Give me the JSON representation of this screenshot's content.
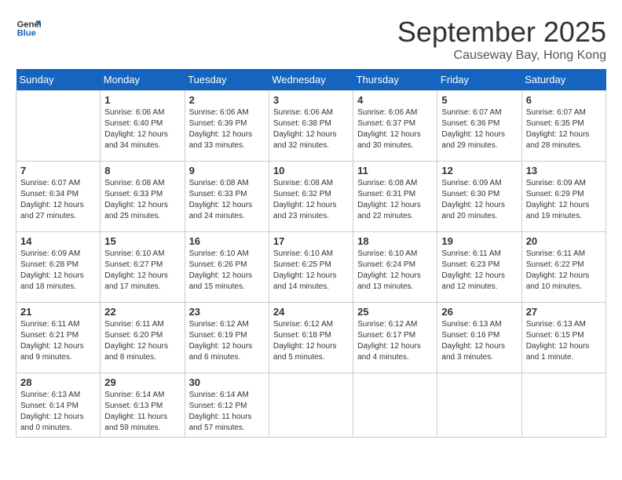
{
  "logo": {
    "general": "General",
    "blue": "Blue"
  },
  "title": {
    "month": "September 2025",
    "location": "Causeway Bay, Hong Kong"
  },
  "days_of_week": [
    "Sunday",
    "Monday",
    "Tuesday",
    "Wednesday",
    "Thursday",
    "Friday",
    "Saturday"
  ],
  "weeks": [
    [
      {
        "day": "",
        "info": ""
      },
      {
        "day": "1",
        "info": "Sunrise: 6:06 AM\nSunset: 6:40 PM\nDaylight: 12 hours\nand 34 minutes."
      },
      {
        "day": "2",
        "info": "Sunrise: 6:06 AM\nSunset: 6:39 PM\nDaylight: 12 hours\nand 33 minutes."
      },
      {
        "day": "3",
        "info": "Sunrise: 6:06 AM\nSunset: 6:38 PM\nDaylight: 12 hours\nand 32 minutes."
      },
      {
        "day": "4",
        "info": "Sunrise: 6:06 AM\nSunset: 6:37 PM\nDaylight: 12 hours\nand 30 minutes."
      },
      {
        "day": "5",
        "info": "Sunrise: 6:07 AM\nSunset: 6:36 PM\nDaylight: 12 hours\nand 29 minutes."
      },
      {
        "day": "6",
        "info": "Sunrise: 6:07 AM\nSunset: 6:35 PM\nDaylight: 12 hours\nand 28 minutes."
      }
    ],
    [
      {
        "day": "7",
        "info": "Sunrise: 6:07 AM\nSunset: 6:34 PM\nDaylight: 12 hours\nand 27 minutes."
      },
      {
        "day": "8",
        "info": "Sunrise: 6:08 AM\nSunset: 6:33 PM\nDaylight: 12 hours\nand 25 minutes."
      },
      {
        "day": "9",
        "info": "Sunrise: 6:08 AM\nSunset: 6:33 PM\nDaylight: 12 hours\nand 24 minutes."
      },
      {
        "day": "10",
        "info": "Sunrise: 6:08 AM\nSunset: 6:32 PM\nDaylight: 12 hours\nand 23 minutes."
      },
      {
        "day": "11",
        "info": "Sunrise: 6:08 AM\nSunset: 6:31 PM\nDaylight: 12 hours\nand 22 minutes."
      },
      {
        "day": "12",
        "info": "Sunrise: 6:09 AM\nSunset: 6:30 PM\nDaylight: 12 hours\nand 20 minutes."
      },
      {
        "day": "13",
        "info": "Sunrise: 6:09 AM\nSunset: 6:29 PM\nDaylight: 12 hours\nand 19 minutes."
      }
    ],
    [
      {
        "day": "14",
        "info": "Sunrise: 6:09 AM\nSunset: 6:28 PM\nDaylight: 12 hours\nand 18 minutes."
      },
      {
        "day": "15",
        "info": "Sunrise: 6:10 AM\nSunset: 6:27 PM\nDaylight: 12 hours\nand 17 minutes."
      },
      {
        "day": "16",
        "info": "Sunrise: 6:10 AM\nSunset: 6:26 PM\nDaylight: 12 hours\nand 15 minutes."
      },
      {
        "day": "17",
        "info": "Sunrise: 6:10 AM\nSunset: 6:25 PM\nDaylight: 12 hours\nand 14 minutes."
      },
      {
        "day": "18",
        "info": "Sunrise: 6:10 AM\nSunset: 6:24 PM\nDaylight: 12 hours\nand 13 minutes."
      },
      {
        "day": "19",
        "info": "Sunrise: 6:11 AM\nSunset: 6:23 PM\nDaylight: 12 hours\nand 12 minutes."
      },
      {
        "day": "20",
        "info": "Sunrise: 6:11 AM\nSunset: 6:22 PM\nDaylight: 12 hours\nand 10 minutes."
      }
    ],
    [
      {
        "day": "21",
        "info": "Sunrise: 6:11 AM\nSunset: 6:21 PM\nDaylight: 12 hours\nand 9 minutes."
      },
      {
        "day": "22",
        "info": "Sunrise: 6:11 AM\nSunset: 6:20 PM\nDaylight: 12 hours\nand 8 minutes."
      },
      {
        "day": "23",
        "info": "Sunrise: 6:12 AM\nSunset: 6:19 PM\nDaylight: 12 hours\nand 6 minutes."
      },
      {
        "day": "24",
        "info": "Sunrise: 6:12 AM\nSunset: 6:18 PM\nDaylight: 12 hours\nand 5 minutes."
      },
      {
        "day": "25",
        "info": "Sunrise: 6:12 AM\nSunset: 6:17 PM\nDaylight: 12 hours\nand 4 minutes."
      },
      {
        "day": "26",
        "info": "Sunrise: 6:13 AM\nSunset: 6:16 PM\nDaylight: 12 hours\nand 3 minutes."
      },
      {
        "day": "27",
        "info": "Sunrise: 6:13 AM\nSunset: 6:15 PM\nDaylight: 12 hours\nand 1 minute."
      }
    ],
    [
      {
        "day": "28",
        "info": "Sunrise: 6:13 AM\nSunset: 6:14 PM\nDaylight: 12 hours\nand 0 minutes."
      },
      {
        "day": "29",
        "info": "Sunrise: 6:14 AM\nSunset: 6:13 PM\nDaylight: 11 hours\nand 59 minutes."
      },
      {
        "day": "30",
        "info": "Sunrise: 6:14 AM\nSunset: 6:12 PM\nDaylight: 11 hours\nand 57 minutes."
      },
      {
        "day": "",
        "info": ""
      },
      {
        "day": "",
        "info": ""
      },
      {
        "day": "",
        "info": ""
      },
      {
        "day": "",
        "info": ""
      }
    ]
  ]
}
